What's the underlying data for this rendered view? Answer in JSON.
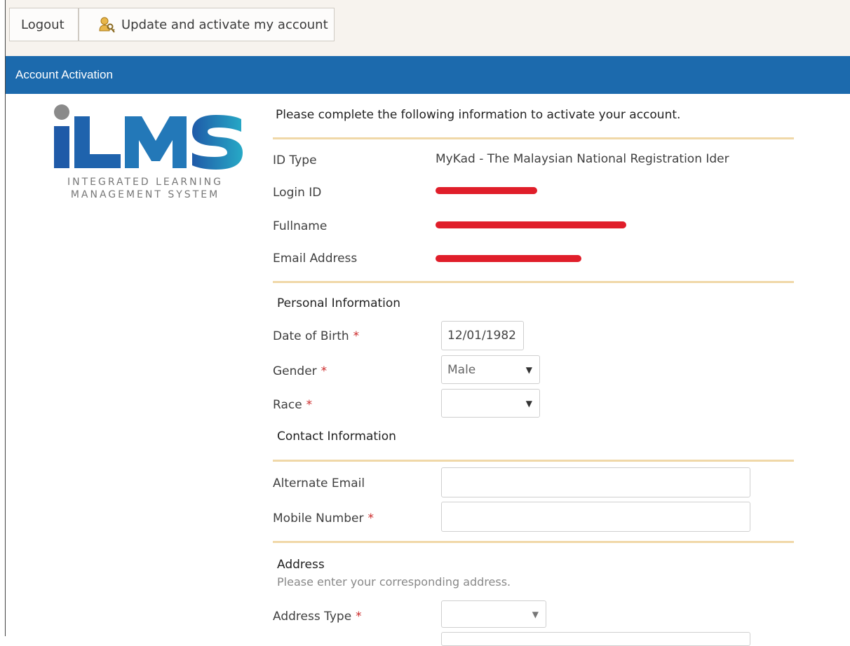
{
  "toolbar": {
    "logout_label": "Logout",
    "activate_label": "Update and activate my account"
  },
  "titlebar": {
    "title": "Account Activation"
  },
  "logo": {
    "wordmark": "iLMS",
    "line1": "INTEGRATED LEARNING",
    "line2": "MANAGEMENT SYSTEM"
  },
  "intro": "Please complete the following information to activate your account.",
  "account": {
    "id_type_label": "ID Type",
    "id_type_value": "MyKad - The Malaysian National Registration Ider",
    "login_id_label": "Login ID",
    "fullname_label": "Fullname",
    "email_label": "Email Address"
  },
  "personal": {
    "heading": "Personal Information",
    "dob_label": "Date of Birth",
    "dob_value": "12/01/1982",
    "gender_label": "Gender",
    "gender_value": "Male",
    "race_label": "Race",
    "race_value": ""
  },
  "contact": {
    "heading": "Contact Information",
    "alt_email_label": "Alternate Email",
    "alt_email_value": "",
    "mobile_label": "Mobile Number",
    "mobile_value": ""
  },
  "address": {
    "heading": "Address",
    "note": "Please enter your corresponding address.",
    "type_label": "Address Type",
    "type_value": ""
  },
  "required_marker": "*",
  "colors": {
    "titlebar": "#1c6aad",
    "toolbar_bg": "#f7f3ee",
    "separator": "#f0d8a8",
    "required": "#cc2a2a",
    "redaction": "#e01e2a"
  },
  "icons": {
    "activate": "key-user-icon",
    "select_caret": "chevron-down-icon"
  }
}
